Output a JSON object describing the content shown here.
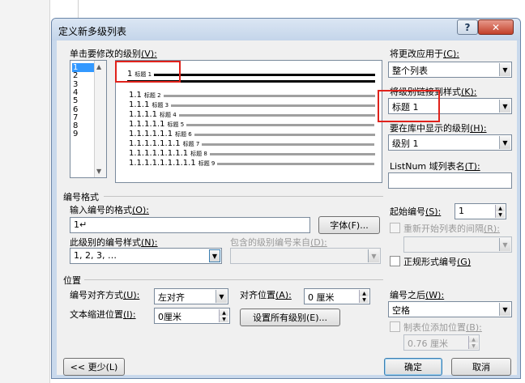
{
  "dialog": {
    "title": "定义新多级列表",
    "help_label": "?",
    "close_label": "✕"
  },
  "level_section": {
    "label": "单击要修改的级别",
    "hotkey": "(V):",
    "levels": [
      "1",
      "2",
      "3",
      "4",
      "5",
      "6",
      "7",
      "8",
      "9"
    ],
    "selected": "1"
  },
  "preview": {
    "rows": [
      {
        "num": "1",
        "text": "标题 1"
      },
      {
        "num": "1.1",
        "text": "标题 2"
      },
      {
        "num": "1.1.1",
        "text": "标题 3"
      },
      {
        "num": "1.1.1.1",
        "text": "标题 4"
      },
      {
        "num": "1.1.1.1.1",
        "text": "标题 5"
      },
      {
        "num": "1.1.1.1.1.1",
        "text": "标题 6"
      },
      {
        "num": "1.1.1.1.1.1.1",
        "text": "标题 7"
      },
      {
        "num": "1.1.1.1.1.1.1.1",
        "text": "标题 8"
      },
      {
        "num": "1.1.1.1.1.1.1.1.1",
        "text": "标题 9"
      }
    ]
  },
  "right_panel": {
    "apply_to_label": "将更改应用于",
    "apply_to_hotkey": "(C):",
    "apply_to_value": "整个列表",
    "link_style_label": "将级别链接到样式",
    "link_style_hotkey": "(K):",
    "link_style_value": "标题 1",
    "gallery_level_label": "要在库中显示的级别",
    "gallery_level_hotkey": "(H):",
    "gallery_level_value": "级别 1",
    "listnum_label": "ListNum 域列表名",
    "listnum_hotkey": "(T):",
    "listnum_value": ""
  },
  "number_format": {
    "group_label": "编号格式",
    "format_label": "输入编号的格式",
    "format_hotkey": "(O):",
    "format_value": "1↵",
    "font_button": "字体(F)...",
    "style_label": "此级别的编号样式",
    "style_hotkey": "(N):",
    "style_value": "1, 2, 3, …",
    "include_label": "包含的级别编号来自",
    "include_hotkey": "(D):",
    "include_value": "",
    "start_label": "起始编号",
    "start_hotkey": "(S):",
    "start_value": "1",
    "restart_label": "重新开始列表的间隔",
    "restart_hotkey": "(R):",
    "restart_value": "",
    "legal_label": "正规形式编号",
    "legal_hotkey": "(G)"
  },
  "position": {
    "group_label": "位置",
    "align_label": "编号对齐方式",
    "align_hotkey": "(U):",
    "align_value": "左对齐",
    "align_at_label": "对齐位置",
    "align_at_hotkey": "(A):",
    "align_at_value": "0 厘米",
    "indent_label": "文本缩进位置",
    "indent_hotkey": "(I):",
    "indent_value": "0厘米",
    "set_all_button": "设置所有级别(E)...",
    "follow_label": "编号之后",
    "follow_hotkey": "(W):",
    "follow_value": "空格",
    "tab_stop_label": "制表位添加位置",
    "tab_stop_hotkey": "(B):",
    "tab_stop_value": "0.76 厘米"
  },
  "footer": {
    "less_button": "<< 更少(L)",
    "ok_button": "确定",
    "cancel_button": "取消"
  },
  "colors": {
    "highlight": "#e0221b",
    "selection": "#3399ff"
  }
}
